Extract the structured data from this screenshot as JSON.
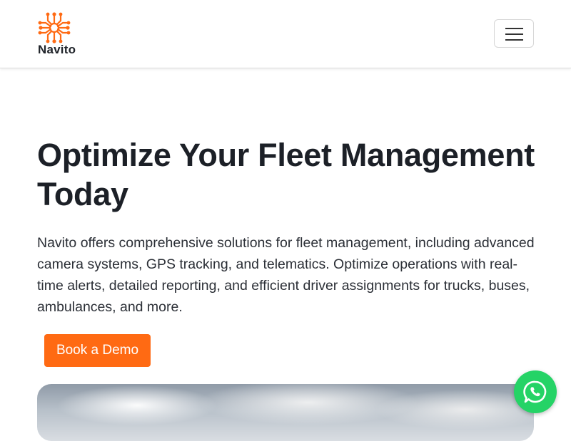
{
  "brand": {
    "name": "Navito",
    "logo_icon": "circuit-network-icon",
    "accent_color": "#ff6a13"
  },
  "nav": {
    "menu_icon": "hamburger-menu-icon"
  },
  "hero": {
    "title": "Optimize Your Fleet Management Today",
    "description": "Navito offers comprehensive solutions for fleet management, including advanced camera systems, GPS tracking, and telematics. Optimize operations with real-time alerts, detailed reporting, and efficient driver assignments for trucks, buses, ambulances, and more.",
    "cta_label": "Book a Demo",
    "cta_color": "#ff6a13",
    "image": "sky-clouds-image"
  },
  "chat": {
    "icon": "whatsapp-icon",
    "color": "#25d366"
  }
}
